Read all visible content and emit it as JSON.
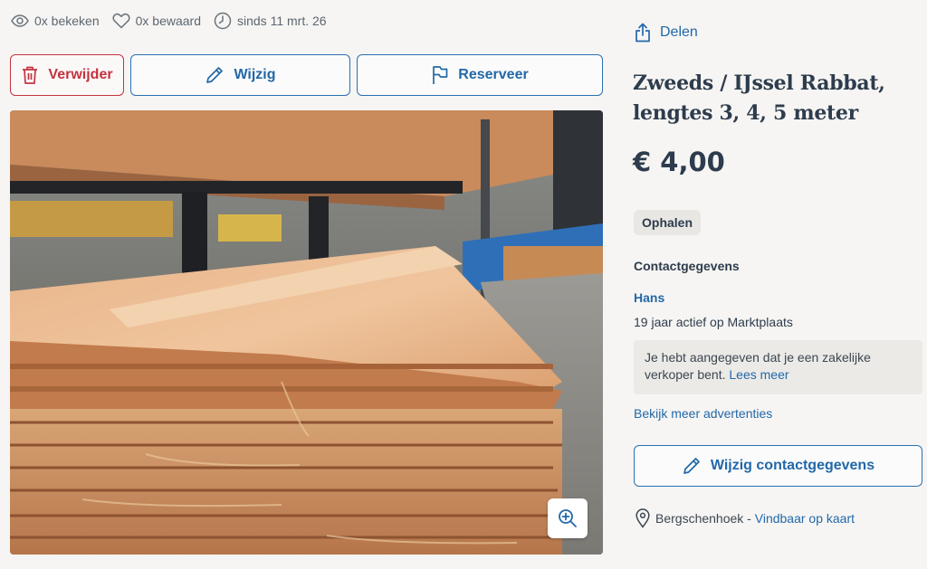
{
  "stats": {
    "views": "0x bekeken",
    "saved": "0x bewaard",
    "since": "sinds 11 mrt. 26"
  },
  "actions": {
    "delete_label": "Verwijder",
    "edit_label": "Wijzig",
    "reserve_label": "Reserveer"
  },
  "share_label": "Delen",
  "listing": {
    "title_line1": "Zweeds / IJssel Rabbat,",
    "title_line2": "lengtes 3, 4, 5 meter",
    "price": "€ 4,00",
    "delivery_badge": "Ophalen"
  },
  "contact": {
    "heading": "Contactgegevens",
    "seller_name": "Hans",
    "seller_active": "19 jaar actief op Marktplaats",
    "business_notice": "Je hebt aangegeven dat je een zakelijke verkoper bent.",
    "business_notice_link": "Lees meer",
    "more_ads_label": "Bekijk meer advertenties",
    "edit_contact_label": "Wijzig contactgegevens"
  },
  "location": {
    "city": "Bergschenhoek",
    "separator": " - ",
    "map_link": "Vindbaar op kaart"
  },
  "colors": {
    "link": "#2368a8",
    "danger": "#c3333f",
    "text": "#2d3c4d",
    "background": "#f6f5f3"
  },
  "icons": {
    "views": "eye-icon",
    "saved": "heart-icon",
    "since": "clock-icon",
    "delete": "trash-icon",
    "edit": "pencil-icon",
    "reserve": "flag-icon",
    "share": "share-icon",
    "zoom": "zoom-in-icon",
    "location": "location-pin-icon"
  }
}
